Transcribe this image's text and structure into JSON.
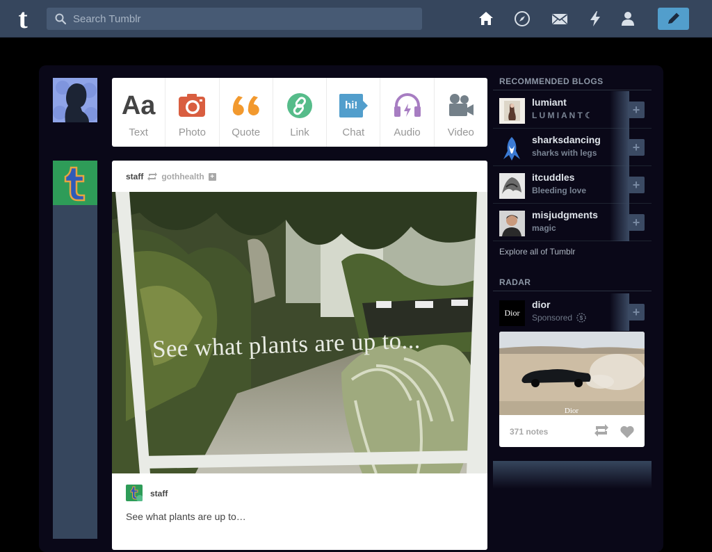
{
  "header": {
    "logo": "t",
    "search_placeholder": "Search Tumblr",
    "nav": [
      "home-icon",
      "explore-icon",
      "inbox-icon",
      "activity-icon",
      "account-icon"
    ],
    "compose": "pencil-icon"
  },
  "colors": {
    "header_bg": "#36465d",
    "compose_bg": "#529ecc",
    "text_icon": "#444444",
    "photo_icon": "#d95e40",
    "quote_icon": "#f2992e",
    "link_icon": "#56bc8a",
    "chat_icon": "#529ecc",
    "audio_icon": "#a77dc2",
    "video_icon": "#748089"
  },
  "post_types": [
    {
      "label": "Text",
      "icon": "Aa"
    },
    {
      "label": "Photo",
      "icon": "camera-icon"
    },
    {
      "label": "Quote",
      "icon": "quote-icon"
    },
    {
      "label": "Link",
      "icon": "link-icon"
    },
    {
      "label": "Chat",
      "icon": "hi!"
    },
    {
      "label": "Audio",
      "icon": "headphones-icon"
    },
    {
      "label": "Video",
      "icon": "video-camera-icon"
    }
  ],
  "post": {
    "author": "staff",
    "reblogged_from": "gothhealth",
    "image_caption": "See what plants are up to...",
    "footer_author": "staff",
    "body": "See what plants are up to…"
  },
  "sidebar": {
    "recommended_title": "RECOMMENDED BLOGS",
    "blogs": [
      {
        "name": "lumiant",
        "tagline": "L U M I A N T ☾"
      },
      {
        "name": "sharksdancing",
        "tagline": "sharks with legs"
      },
      {
        "name": "itcuddles",
        "tagline": "Bleeding love"
      },
      {
        "name": "misjudgments",
        "tagline": "magic"
      }
    ],
    "explore_link": "Explore all of Tumblr",
    "radar_title": "RADAR",
    "radar": {
      "name": "dior",
      "tag": "Sponsored",
      "logo_text": "Dior",
      "photo_watermark": "Dior",
      "notes": "371 notes"
    }
  }
}
